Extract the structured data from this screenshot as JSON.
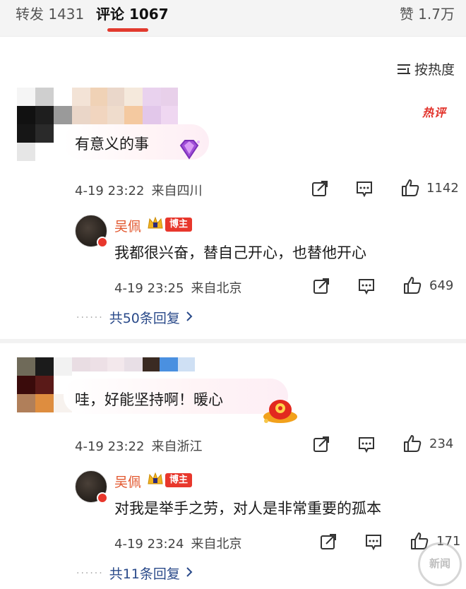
{
  "tabs": {
    "reposts": "转发 1431",
    "comments": "评论 1067",
    "likes": "赞 1.7万"
  },
  "sort": {
    "label": "按热度",
    "icon": "sort-icon"
  },
  "colors": {
    "accent": "#e23a2e",
    "author_name": "#e2572e",
    "link": "#2a4a8a"
  },
  "comments": [
    {
      "hot_badge": "热评",
      "text": "有意义的事",
      "time": "4-19 23:22",
      "location": "来自四川",
      "likes": "1142",
      "reply": {
        "author": "吴佩",
        "tag": "博主",
        "text": "我都很兴奋，替自己开心，也替他开心",
        "time": "4-19 23:25",
        "location": "来自北京",
        "likes": "649"
      },
      "more_replies": "共50条回复"
    },
    {
      "text": "哇，好能坚持啊！暖心",
      "time": "4-19 23:22",
      "location": "来自浙江",
      "likes": "234",
      "reply": {
        "author": "吴佩",
        "tag": "博主",
        "text": "对我是举手之劳，对人是非常重要的孤本",
        "time": "4-19 23:24",
        "location": "来自北京",
        "likes": "171"
      },
      "more_replies": "共11条回复"
    }
  ],
  "watermark": "新闻"
}
